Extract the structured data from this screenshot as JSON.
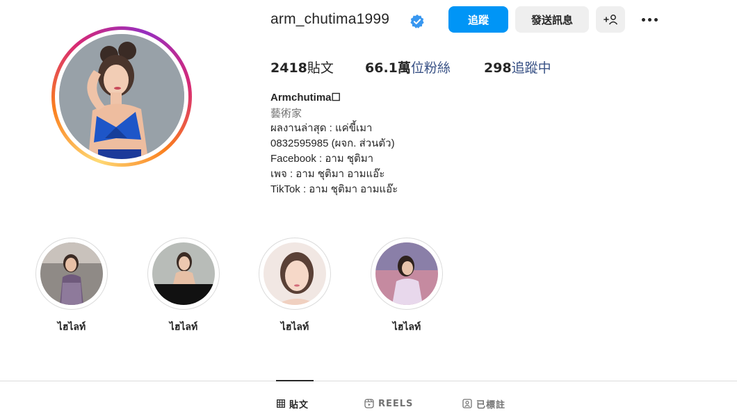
{
  "profile": {
    "username": "arm_chutima1999",
    "verified_icon": "verified-badge-icon",
    "follow_label": "追蹤",
    "message_label": "發送訊息",
    "add_user_label": "+♀",
    "more_icon": "more-options-icon"
  },
  "stats": {
    "posts_count": "2418",
    "posts_label": "貼文",
    "followers_count": "66.1萬",
    "followers_label": "位粉絲",
    "following_count": "298",
    "following_label": "追蹤中"
  },
  "bio": {
    "name": "Armchutima☐",
    "category": "藝術家",
    "lines": [
      "ผลงานล่าสุด : แค่ขี้เมา",
      "0832595985 (ผจก. ส่วนตัว)",
      "Facebook : อาม ชุติมา",
      "เพจ : อาม ชุติมา อามแอ๊ะ",
      "TikTok : อาม ชุติมา อามแอ๊ะ"
    ]
  },
  "highlights": [
    {
      "label": "ไฮไลท์"
    },
    {
      "label": "ไฮไลท์"
    },
    {
      "label": "ไฮไลท์"
    },
    {
      "label": "ไฮไลท์"
    }
  ],
  "tabs": [
    {
      "label": "貼文",
      "icon": "grid-icon",
      "active": true
    },
    {
      "label": "REELS",
      "icon": "reels-icon",
      "active": false
    },
    {
      "label": "已標註",
      "icon": "tagged-icon",
      "active": false
    }
  ],
  "colors": {
    "primary_button": "#0095f6",
    "secondary_button": "#efefef",
    "link_blue": "#385185",
    "muted_text": "#737373"
  }
}
